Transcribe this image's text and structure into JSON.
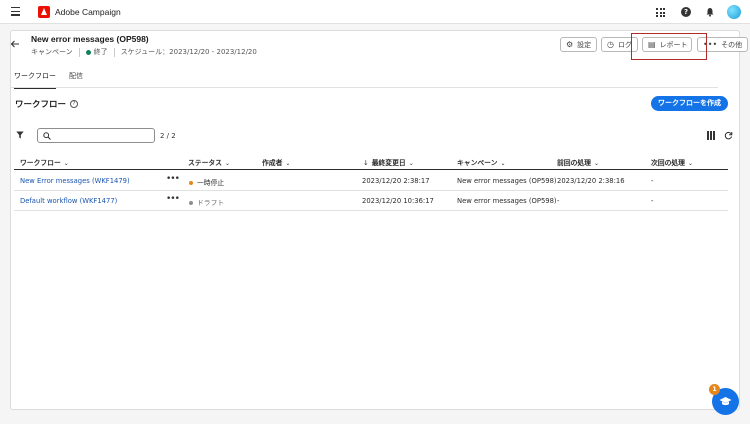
{
  "app": {
    "brand": "Adobe Campaign"
  },
  "header": {
    "title": "New error messages (OP598)",
    "campaign_label": "キャンペーン",
    "status": "終了",
    "schedule": "スケジュール：2023/12/20 - 2023/12/20",
    "buttons": {
      "settings": "設定",
      "log": "ログ",
      "report": "レポート",
      "more": "その他"
    }
  },
  "tabs": [
    "ワークフロー",
    "配信"
  ],
  "section": {
    "title": "ワークフロー",
    "create_button": "ワークフローを作成"
  },
  "search": {
    "placeholder": "",
    "count": "2 / 2"
  },
  "table": {
    "columns": [
      "ワークフロー",
      "ステータス",
      "作成者",
      "最終変更日",
      "キャンペーン",
      "前回の処理",
      "次回の処理"
    ],
    "rows": [
      {
        "name": "New Error messages (WKF1479)",
        "status": "一時停止",
        "status_color": "#e68619",
        "author": "",
        "modified": "2023/12/20 2:38:17",
        "campaign": "New error messages (OP598)",
        "last_run": "2023/12/20 2:38:16",
        "next_run": "-"
      },
      {
        "name": "Default workflow (WKF1477)",
        "status": "ドラフト",
        "status_color": "#8e8e8e",
        "author": "",
        "modified": "2023/12/20 10:36:17",
        "campaign": "New error messages (OP598)",
        "last_run": "-",
        "next_run": "-"
      }
    ]
  },
  "fab_badge": "1",
  "colors": {
    "accent": "#1473e6",
    "brand": "#eb1000",
    "success": "#12805c"
  }
}
